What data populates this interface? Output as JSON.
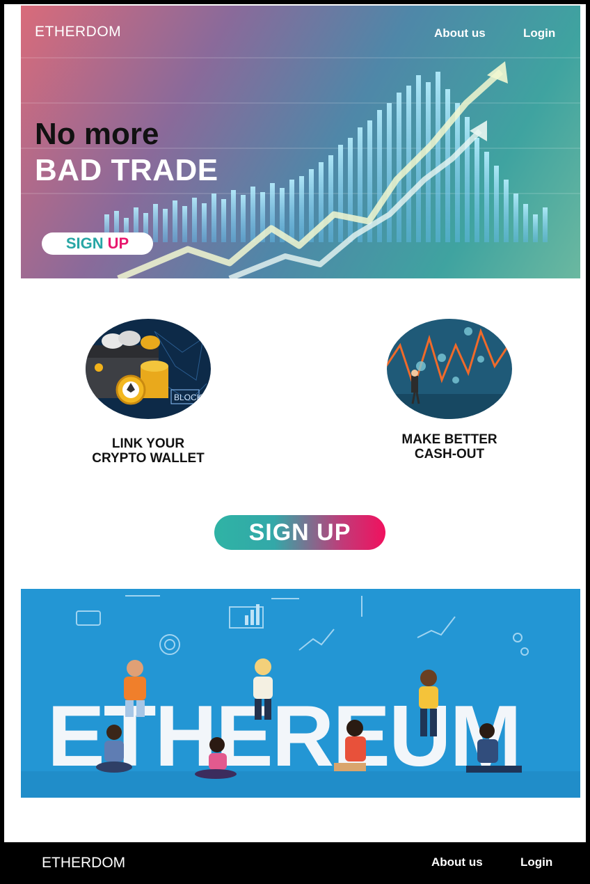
{
  "header": {
    "brand": "ETHERDOM",
    "nav": [
      {
        "label": "About us"
      },
      {
        "label": "Login"
      }
    ]
  },
  "hero": {
    "line1": "No more",
    "line2": "BAD TRADE",
    "signup_word1": "SIGN",
    "signup_word2": "UP"
  },
  "features": [
    {
      "line1": "LINK  YOUR",
      "line2": "CRYPTO WALLET",
      "icon": "crypto-wallet-icon",
      "chip_text": "BLOCK"
    },
    {
      "line1": "MAKE BETTER",
      "line2": "CASH-OUT",
      "icon": "market-chart-icon"
    }
  ],
  "main_signup": "SIGN UP",
  "banner": {
    "word": "ETHEREUM"
  },
  "footer": {
    "brand": "ETHERDOM",
    "nav": [
      {
        "label": "About us"
      },
      {
        "label": "Login"
      }
    ]
  },
  "colors": {
    "signup_teal": "#27a6a5",
    "signup_pink": "#e8186e",
    "banner_blue": "#2396d4"
  }
}
